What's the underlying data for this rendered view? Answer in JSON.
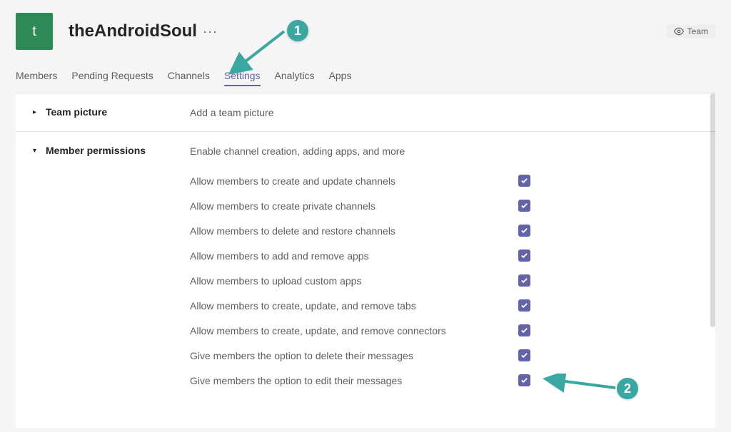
{
  "header": {
    "avatar_letter": "t",
    "team_name": "theAndroidSoul",
    "more_label": "···",
    "team_badge": "Team"
  },
  "tabs": [
    {
      "label": "Members",
      "active": false
    },
    {
      "label": "Pending Requests",
      "active": false
    },
    {
      "label": "Channels",
      "active": false
    },
    {
      "label": "Settings",
      "active": true
    },
    {
      "label": "Analytics",
      "active": false
    },
    {
      "label": "Apps",
      "active": false
    }
  ],
  "sections": {
    "team_picture": {
      "title": "Team picture",
      "desc": "Add a team picture"
    },
    "member_permissions": {
      "title": "Member permissions",
      "desc": "Enable channel creation, adding apps, and more",
      "options": [
        {
          "label": "Allow members to create and update channels",
          "checked": true
        },
        {
          "label": "Allow members to create private channels",
          "checked": true
        },
        {
          "label": "Allow members to delete and restore channels",
          "checked": true
        },
        {
          "label": "Allow members to add and remove apps",
          "checked": true
        },
        {
          "label": "Allow members to upload custom apps",
          "checked": true
        },
        {
          "label": "Allow members to create, update, and remove tabs",
          "checked": true
        },
        {
          "label": "Allow members to create, update, and remove connectors",
          "checked": true
        },
        {
          "label": "Give members the option to delete their messages",
          "checked": true
        },
        {
          "label": "Give members the option to edit their messages",
          "checked": true
        }
      ]
    }
  },
  "annotations": {
    "badge1": "1",
    "badge2": "2"
  }
}
